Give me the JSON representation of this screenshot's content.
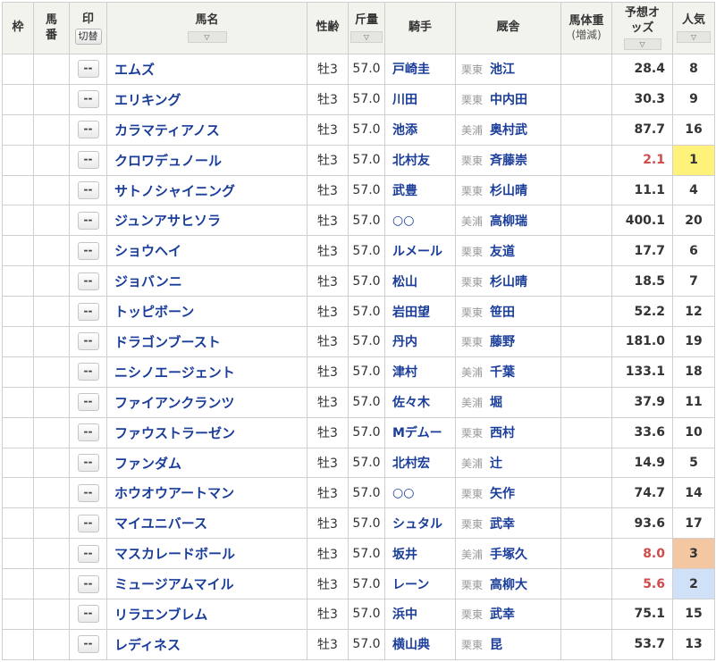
{
  "header": {
    "waku": "枠",
    "umaban": "馬番",
    "mark": "印",
    "mark_toggle": "切替",
    "name": "馬名",
    "sexage": "性齢",
    "weight": "斤量",
    "jockey": "騎手",
    "stable": "厩舎",
    "bodyweight": "馬体重",
    "bodyweight_sub": "(増減)",
    "odds": "予想オッズ",
    "pop": "人気",
    "sort_glyph": "▽"
  },
  "rows": [
    {
      "mark": "--",
      "name": "エムズ",
      "sexage": "牡3",
      "weight": "57.0",
      "jockey": "戸崎圭",
      "area": "栗東",
      "trainer": "池江",
      "odds": "28.4",
      "pop": "8"
    },
    {
      "mark": "--",
      "name": "エリキング",
      "sexage": "牡3",
      "weight": "57.0",
      "jockey": "川田",
      "area": "栗東",
      "trainer": "中内田",
      "odds": "30.3",
      "pop": "9"
    },
    {
      "mark": "--",
      "name": "カラマティアノス",
      "sexage": "牡3",
      "weight": "57.0",
      "jockey": "池添",
      "area": "美浦",
      "trainer": "奥村武",
      "odds": "87.7",
      "pop": "16"
    },
    {
      "mark": "--",
      "name": "クロワデュノール",
      "sexage": "牡3",
      "weight": "57.0",
      "jockey": "北村友",
      "area": "栗東",
      "trainer": "斉藤崇",
      "odds": "2.1",
      "pop": "1"
    },
    {
      "mark": "--",
      "name": "サトノシャイニング",
      "sexage": "牡3",
      "weight": "57.0",
      "jockey": "武豊",
      "area": "栗東",
      "trainer": "杉山晴",
      "odds": "11.1",
      "pop": "4"
    },
    {
      "mark": "--",
      "name": "ジュンアサヒソラ",
      "sexage": "牡3",
      "weight": "57.0",
      "jockey": "○○",
      "area": "美浦",
      "trainer": "高柳瑞",
      "odds": "400.1",
      "pop": "20"
    },
    {
      "mark": "--",
      "name": "ショウヘイ",
      "sexage": "牡3",
      "weight": "57.0",
      "jockey": "ルメール",
      "area": "栗東",
      "trainer": "友道",
      "odds": "17.7",
      "pop": "6"
    },
    {
      "mark": "--",
      "name": "ジョバンニ",
      "sexage": "牡3",
      "weight": "57.0",
      "jockey": "松山",
      "area": "栗東",
      "trainer": "杉山晴",
      "odds": "18.5",
      "pop": "7"
    },
    {
      "mark": "--",
      "name": "トッピボーン",
      "sexage": "牡3",
      "weight": "57.0",
      "jockey": "岩田望",
      "area": "栗東",
      "trainer": "笹田",
      "odds": "52.2",
      "pop": "12"
    },
    {
      "mark": "--",
      "name": "ドラゴンブースト",
      "sexage": "牡3",
      "weight": "57.0",
      "jockey": "丹内",
      "area": "栗東",
      "trainer": "藤野",
      "odds": "181.0",
      "pop": "19"
    },
    {
      "mark": "--",
      "name": "ニシノエージェント",
      "sexage": "牡3",
      "weight": "57.0",
      "jockey": "津村",
      "area": "美浦",
      "trainer": "千葉",
      "odds": "133.1",
      "pop": "18"
    },
    {
      "mark": "--",
      "name": "ファイアンクランツ",
      "sexage": "牡3",
      "weight": "57.0",
      "jockey": "佐々木",
      "area": "美浦",
      "trainer": "堀",
      "odds": "37.9",
      "pop": "11"
    },
    {
      "mark": "--",
      "name": "ファウストラーゼン",
      "sexage": "牡3",
      "weight": "57.0",
      "jockey": "Mデムー",
      "area": "栗東",
      "trainer": "西村",
      "odds": "33.6",
      "pop": "10"
    },
    {
      "mark": "--",
      "name": "ファンダム",
      "sexage": "牡3",
      "weight": "57.0",
      "jockey": "北村宏",
      "area": "美浦",
      "trainer": "辻",
      "odds": "14.9",
      "pop": "5"
    },
    {
      "mark": "--",
      "name": "ホウオウアートマン",
      "sexage": "牡3",
      "weight": "57.0",
      "jockey": "○○",
      "area": "栗東",
      "trainer": "矢作",
      "odds": "74.7",
      "pop": "14"
    },
    {
      "mark": "--",
      "name": "マイユニバース",
      "sexage": "牡3",
      "weight": "57.0",
      "jockey": "シュタル",
      "area": "栗東",
      "trainer": "武幸",
      "odds": "93.6",
      "pop": "17"
    },
    {
      "mark": "--",
      "name": "マスカレードボール",
      "sexage": "牡3",
      "weight": "57.0",
      "jockey": "坂井",
      "area": "美浦",
      "trainer": "手塚久",
      "odds": "8.0",
      "pop": "3"
    },
    {
      "mark": "--",
      "name": "ミュージアムマイル",
      "sexage": "牡3",
      "weight": "57.0",
      "jockey": "レーン",
      "area": "栗東",
      "trainer": "高柳大",
      "odds": "5.6",
      "pop": "2"
    },
    {
      "mark": "--",
      "name": "リラエンブレム",
      "sexage": "牡3",
      "weight": "57.0",
      "jockey": "浜中",
      "area": "栗東",
      "trainer": "武幸",
      "odds": "75.1",
      "pop": "15"
    },
    {
      "mark": "--",
      "name": "レディネス",
      "sexage": "牡3",
      "weight": "57.0",
      "jockey": "横山典",
      "area": "栗東",
      "trainer": "昆",
      "odds": "53.7",
      "pop": "13"
    }
  ],
  "colors": {
    "link": "#1a3d99",
    "hot_odds": "#d24b4b",
    "pop1": "#fff27a",
    "pop2": "#cfe0f7",
    "pop3": "#f3c7a2"
  }
}
